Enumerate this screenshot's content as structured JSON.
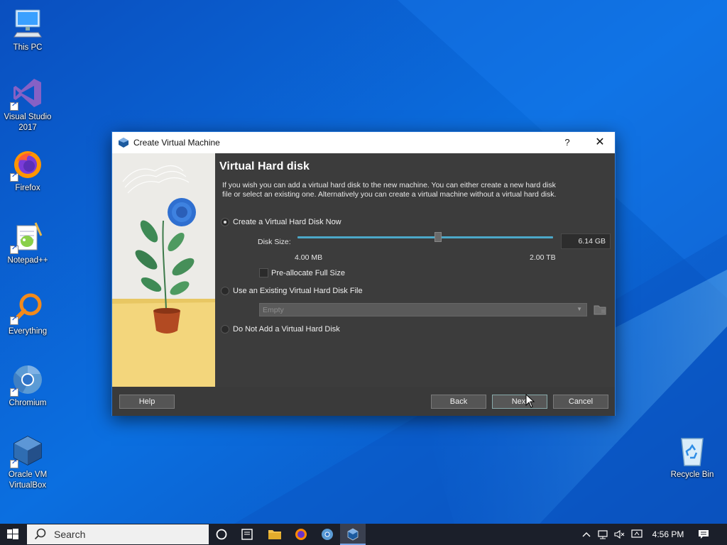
{
  "desktop": {
    "icons": [
      {
        "label": "This PC",
        "icon": "computer-icon"
      },
      {
        "label": "Visual Studio 2017",
        "icon": "visual-studio-icon"
      },
      {
        "label": "Firefox",
        "icon": "firefox-icon"
      },
      {
        "label": "Notepad++",
        "icon": "notepad-plus-icon"
      },
      {
        "label": "Everything",
        "icon": "everything-search-icon"
      },
      {
        "label": "Chromium",
        "icon": "chromium-icon"
      },
      {
        "label": "Oracle VM VirtualBox",
        "icon": "virtualbox-icon"
      },
      {
        "label": "Recycle Bin",
        "icon": "recycle-bin-icon"
      }
    ]
  },
  "dialog": {
    "title": "Create Virtual Machine",
    "help_glyph": "?",
    "close_glyph": "✕",
    "heading": "Virtual Hard disk",
    "description": "If you wish you can add a virtual hard disk to the new machine. You can either create a new hard disk file or select an existing one. Alternatively you can create a virtual machine without a virtual hard disk.",
    "options": {
      "create_new": "Create a Virtual Hard Disk Now",
      "use_existing": "Use an Existing Virtual Hard Disk File",
      "no_disk": "Do Not Add a Virtual Hard Disk"
    },
    "selected_option": "create_new",
    "disk_size_label": "Disk Size:",
    "disk_size_value": "6.14 GB",
    "slider_min": "4.00 MB",
    "slider_max": "2.00 TB",
    "slider_position": 0.55,
    "preallocate_label": "Pre-allocate Full Size",
    "preallocate_checked": false,
    "existing_file_placeholder": "Empty",
    "buttons": {
      "help": "Help",
      "back": "Back",
      "next": "Next",
      "cancel": "Cancel"
    }
  },
  "taskbar": {
    "search_placeholder": "Search",
    "time": "4:56 PM",
    "pinned": [
      "cortana-icon",
      "task-view-icon",
      "file-explorer-icon",
      "firefox-icon",
      "chromium-icon",
      "virtualbox-icon"
    ],
    "tray": [
      "chevron-up-icon",
      "network-icon",
      "volume-muted-icon",
      "screen-icon",
      "notifications-icon"
    ]
  },
  "colors": {
    "wallpaper": "#0b63d6",
    "dialog_bg": "#3c3c3c",
    "accent": "#2a76d2",
    "slider": "#4ca8c8"
  }
}
